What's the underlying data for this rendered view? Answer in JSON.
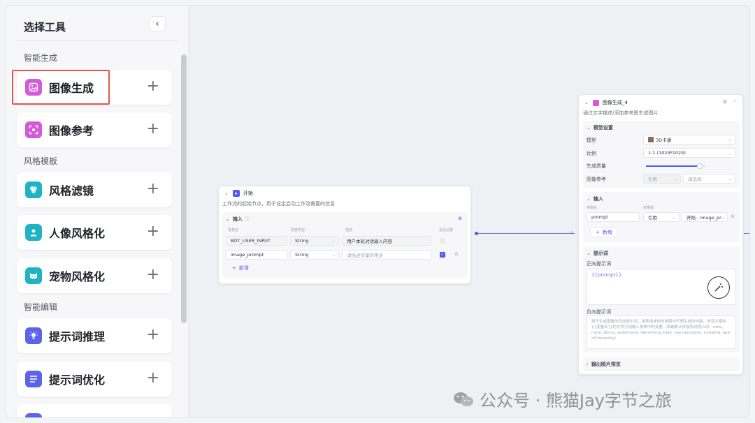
{
  "sidebar": {
    "title": "选择工具",
    "collapse_icon": "‹",
    "sections": [
      {
        "title": "智能生成"
      },
      {
        "title": "风格模板"
      },
      {
        "title": "智能编辑"
      }
    ],
    "items": [
      {
        "label": "图像生成",
        "icon": "image-generate-icon",
        "color": "#d35ad8",
        "plus": "+"
      },
      {
        "label": "图像参考",
        "icon": "image-reference-icon",
        "color": "#d35ad8",
        "plus": "+"
      },
      {
        "label": "风格滤镜",
        "icon": "style-filter-icon",
        "color": "#20b3c4",
        "plus": "+"
      },
      {
        "label": "人像风格化",
        "icon": "portrait-icon",
        "color": "#20b3c4",
        "plus": "+"
      },
      {
        "label": "宠物风格化",
        "icon": "pet-icon",
        "color": "#20b3c4",
        "plus": "+"
      },
      {
        "label": "提示词推理",
        "icon": "bulb-icon",
        "color": "#5b63e8",
        "plus": "+"
      },
      {
        "label": "提示词优化",
        "icon": "list-icon",
        "color": "#5b63e8",
        "plus": "+"
      }
    ]
  },
  "start_node": {
    "title": "开始",
    "desc": "工作流的起始节点，用于设定启动工作流需要的信息",
    "section": "输入",
    "headers": [
      "变量名",
      "变量类型",
      "描述",
      "是否必要"
    ],
    "rows": [
      {
        "name": "BOT_USER_INPUT",
        "type": "String",
        "desc": "用户本轮对话输入内容"
      },
      {
        "name": "image_prompt",
        "type": "String",
        "desc": "请描述变量的用途"
      }
    ],
    "add": "新增"
  },
  "image_node": {
    "title": "图像生成_4",
    "desc": "通过文字描述/添加参考图生成图片",
    "model_section": "模型设置",
    "model_label": "模型",
    "model_value": "3D卡通",
    "ratio_label": "比例",
    "ratio_value": "1:1 (1024*1024)",
    "quality_label": "生成质量",
    "quality_level": 0.9,
    "ref_label": "图像参考",
    "ref_type": "引用",
    "ref_placeholder": "请选择",
    "input_section": "输入",
    "param_header": "参数名",
    "value_header": "变量值",
    "param_name": "prompt",
    "param_ref": "引用",
    "param_value": "开始 - image_pr",
    "add": "新增",
    "prompt_section": "提示词",
    "positive_label": "正向提示词",
    "positive_value": "{{prompt}}",
    "negative_label": "负向提示词",
    "negative_placeholder": "用于生成图像的负向提示词，用来描述你的画面中不想生成的内容。你可以使用{{变量名}}的方式引用输入参数中的变量（系统默认拼接负向提示词：nsfw, nude, blurry, watermark, identifying mark, low resolution, mutated, lack of hierarchy）",
    "preview_section": "输出图片预览"
  },
  "watermark": "公众号 · 熊猫Jay字节之旅"
}
